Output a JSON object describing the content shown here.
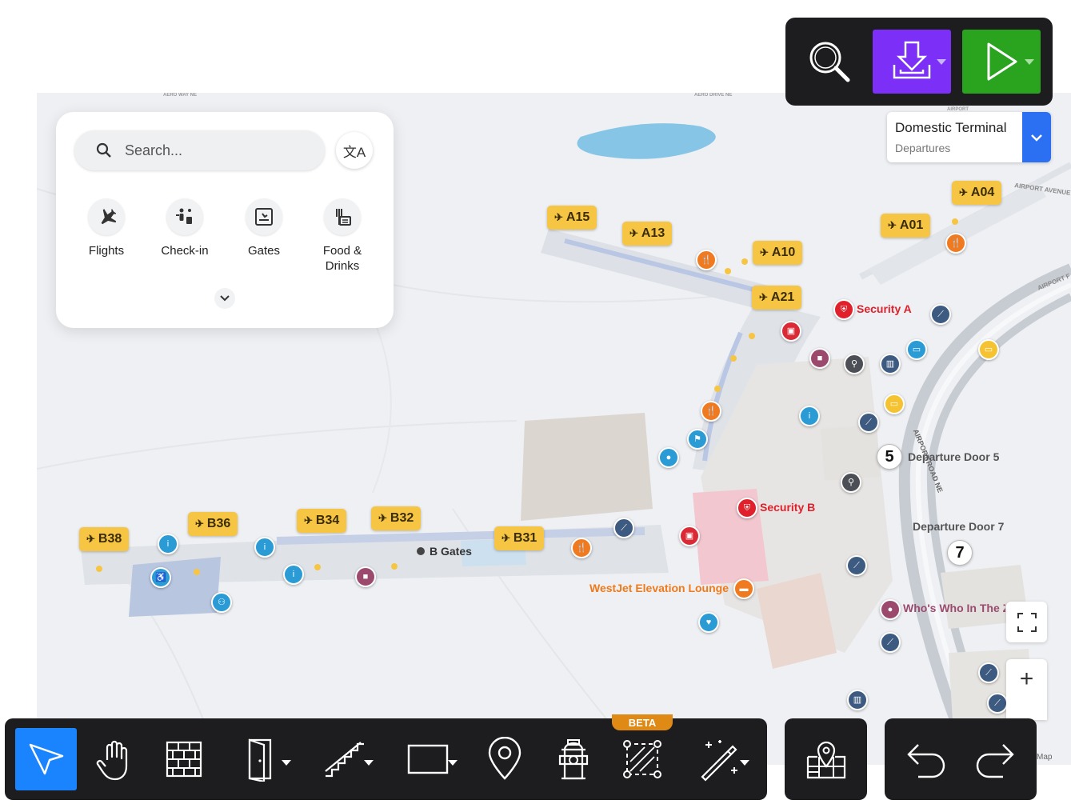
{
  "top_toolbar": {
    "search_icon": "search-icon",
    "import_icon": "download-tray-icon",
    "play_icon": "play-icon",
    "import_color": "#7b2ff7",
    "play_color": "#2aa31f"
  },
  "terminal_selector": {
    "title": "Domestic Terminal",
    "subtitle": "Departures",
    "accent": "#2b6ff3"
  },
  "search_panel": {
    "placeholder": "Search...",
    "categories": [
      {
        "label": "Flights",
        "icon": "plane-icon"
      },
      {
        "label": "Check-in",
        "icon": "check-in-icon"
      },
      {
        "label": "Gates",
        "icon": "gate-icon"
      },
      {
        "label": "Food &\nDrinks",
        "icon": "food-drinks-icon"
      }
    ]
  },
  "map": {
    "gates": [
      "A04",
      "A15",
      "A01",
      "A13",
      "A10",
      "A21",
      "B38",
      "B36",
      "B34",
      "B32",
      "B31"
    ],
    "labels": {
      "security_a": "Security A",
      "security_b": "Security B",
      "b_gates": "B Gates",
      "door5": "Departure Door 5",
      "door7": "Departure Door 7",
      "door5_num": "5",
      "door7_num": "7",
      "lounge": "WestJet Elevation Lounge",
      "whos_who": "Who's Who In The Z",
      "road_airport_ave": "AIRPORT AVENUE",
      "road_airport_f": "AIRPORT F",
      "road_airport_road": "AIRPORT ROAD NE",
      "road_aero_drive": "AERO DRIVE NE",
      "road_aero_way": "AERO WAY NE",
      "road_airport": "AIRPORT",
      "attribution": "Map"
    },
    "colors": {
      "gate": "#f6c544",
      "security": "#e0202a",
      "lounge": "#ee7a1b",
      "water": "#86c5e6"
    }
  },
  "bottom_toolbar": {
    "beta_label": "BETA",
    "tools": [
      {
        "name": "select",
        "icon": "cursor-arrow-icon"
      },
      {
        "name": "pan",
        "icon": "hand-icon"
      },
      {
        "name": "wall",
        "icon": "brick-wall-icon"
      },
      {
        "name": "door",
        "icon": "door-icon"
      },
      {
        "name": "stairs",
        "icon": "stairs-icon"
      },
      {
        "name": "shape",
        "icon": "rectangle-icon"
      },
      {
        "name": "pin",
        "icon": "location-pin-icon"
      },
      {
        "name": "hydrant",
        "icon": "fire-hydrant-icon"
      },
      {
        "name": "area",
        "icon": "area-select-icon"
      },
      {
        "name": "magic",
        "icon": "magic-wand-icon"
      }
    ],
    "map_view_icon": "map-pin-icon",
    "undo_icon": "undo-icon",
    "redo_icon": "redo-icon",
    "active_color": "#1a84ff"
  },
  "map_controls": {
    "fullscreen_icon": "fullscreen-icon",
    "zoom_in_label": "+"
  }
}
